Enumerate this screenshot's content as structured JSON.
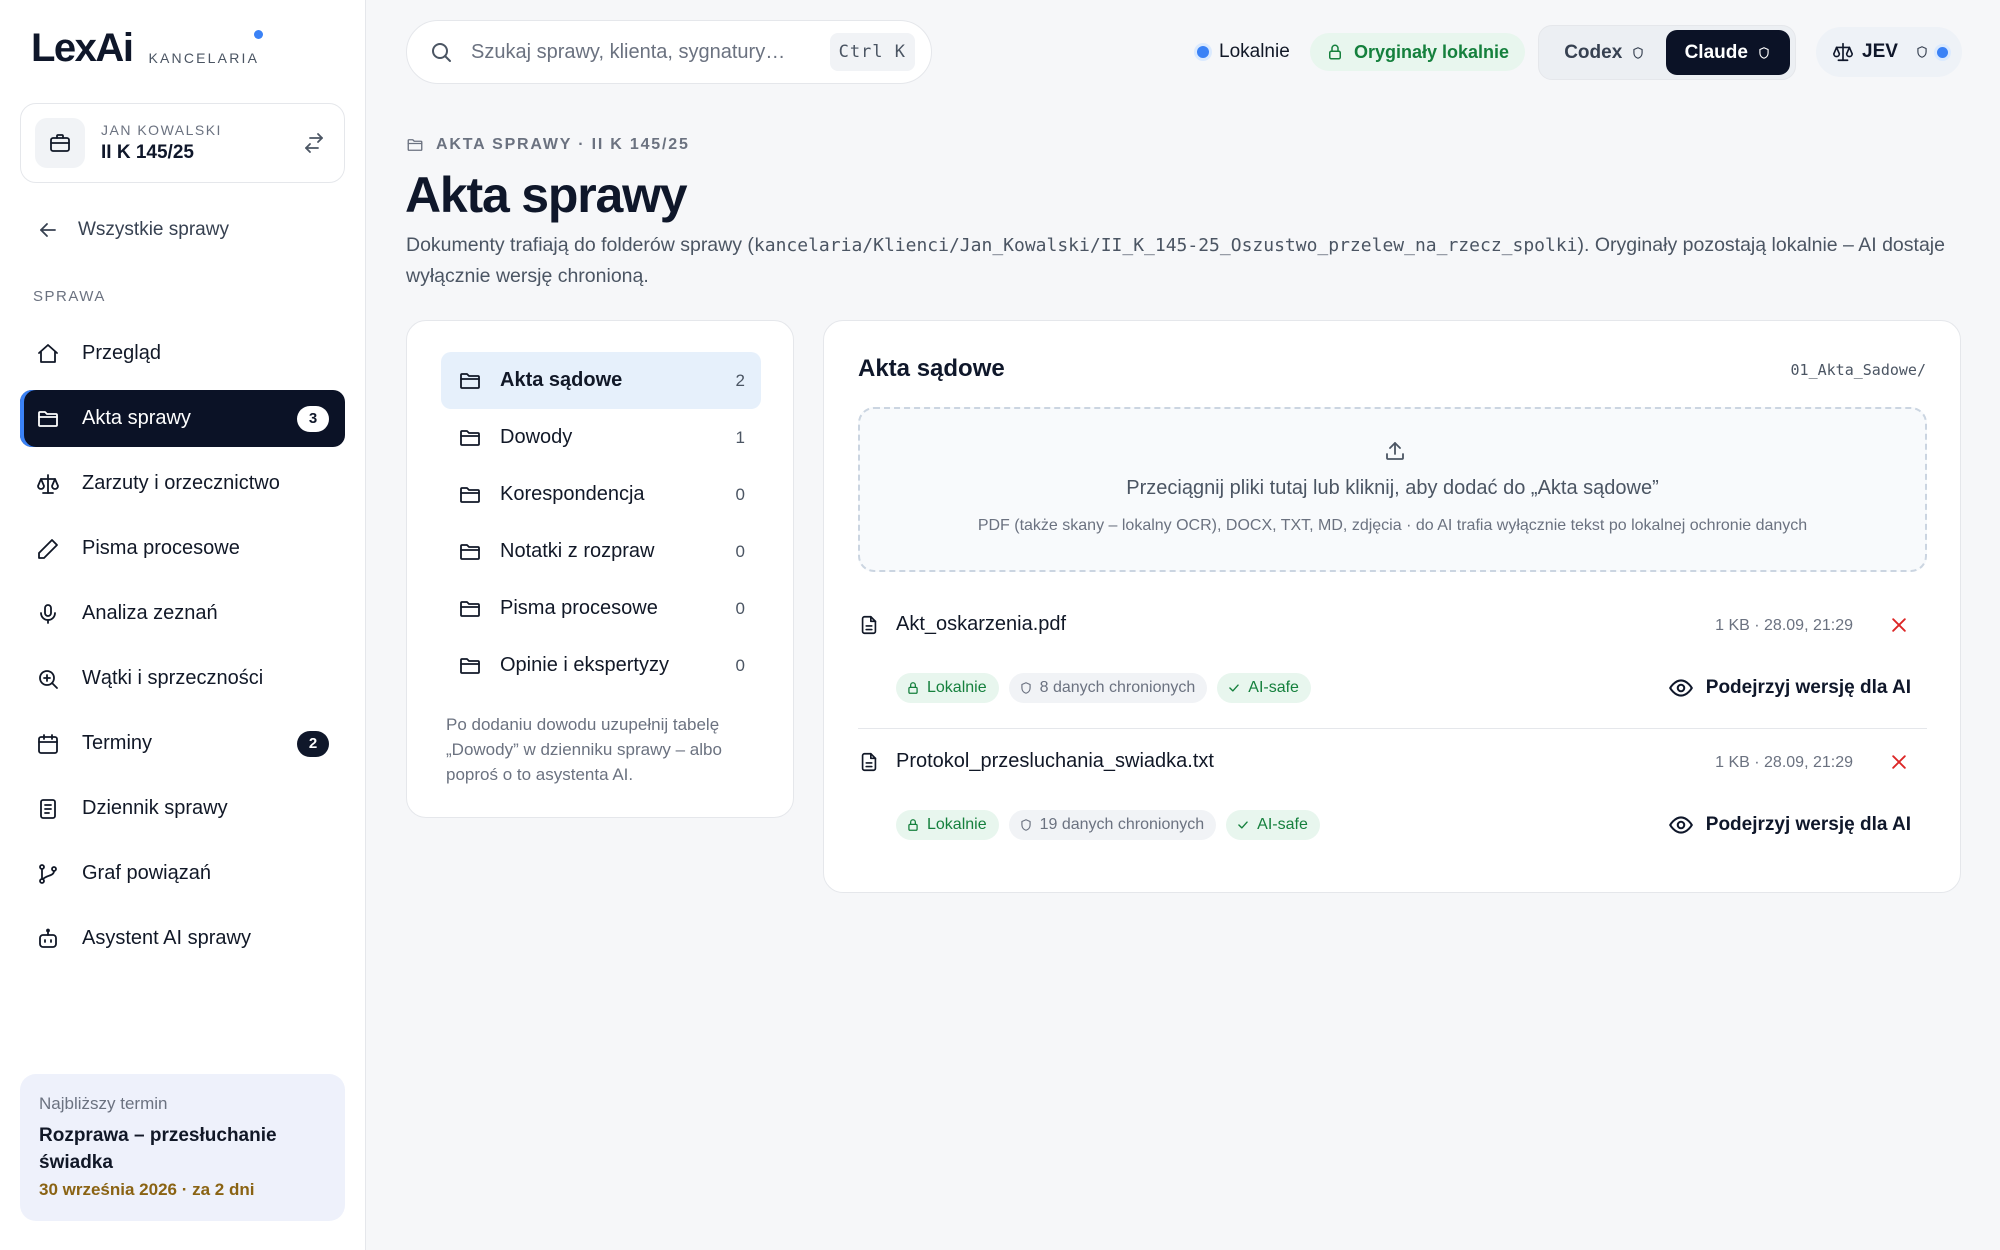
{
  "brand": {
    "name": "LexAi",
    "subtitle": "KANCELARIA"
  },
  "case": {
    "client": "JAN KOWALSKI",
    "signature": "II K 145/25"
  },
  "sidebar": {
    "back_label": "Wszystkie sprawy",
    "section_label": "SPRAWA",
    "items": [
      {
        "label": "Przegląd",
        "icon": "home-icon",
        "badge": ""
      },
      {
        "label": "Akta sprawy",
        "icon": "folder-icon",
        "badge": "3",
        "active": true
      },
      {
        "label": "Zarzuty i orzecznictwo",
        "icon": "scales-icon",
        "badge": ""
      },
      {
        "label": "Pisma procesowe",
        "icon": "pencil-icon",
        "badge": ""
      },
      {
        "label": "Analiza zeznań",
        "icon": "microphone-icon",
        "badge": ""
      },
      {
        "label": "Wątki i sprzeczności",
        "icon": "zoom-in-icon",
        "badge": ""
      },
      {
        "label": "Terminy",
        "icon": "calendar-icon",
        "badge": "2"
      },
      {
        "label": "Dziennik sprawy",
        "icon": "journal-icon",
        "badge": ""
      },
      {
        "label": "Graf powiązań",
        "icon": "git-branch-icon",
        "badge": ""
      },
      {
        "label": "Asystent AI sprawy",
        "icon": "bot-icon",
        "badge": ""
      }
    ],
    "deadline": {
      "label": "Najbliższy termin",
      "title": "Rozprawa – przesłuchanie świadka",
      "when": "30 września 2026 · za 2 dni"
    }
  },
  "topbar": {
    "search_placeholder": "Szukaj sprawy, klienta, sygnatury…",
    "shortcut": "Ctrl K",
    "status_local": "Lokalnie",
    "originals_badge": "Oryginały lokalnie",
    "models": [
      {
        "label": "Codex",
        "active": false
      },
      {
        "label": "Claude",
        "active": true
      }
    ],
    "user_initials": "JEV"
  },
  "page": {
    "breadcrumb": "AKTA SPRAWY · II K 145/25",
    "title": "Akta sprawy",
    "desc_prefix": "Dokumenty trafiają do folderów sprawy (",
    "desc_path": "kancelaria/Klienci/Jan_Kowalski/II_K_145-25_Oszustwo_przelew_na_rzecz_spolki",
    "desc_suffix": "). Oryginały pozostają lokalnie – AI dostaje wyłącznie wersję chronioną."
  },
  "folders": {
    "items": [
      {
        "label": "Akta sądowe",
        "count": "2",
        "active": true
      },
      {
        "label": "Dowody",
        "count": "1"
      },
      {
        "label": "Korespondencja",
        "count": "0"
      },
      {
        "label": "Notatki z rozpraw",
        "count": "0"
      },
      {
        "label": "Pisma procesowe",
        "count": "0"
      },
      {
        "label": "Opinie i ekspertyzy",
        "count": "0"
      }
    ],
    "note": "Po dodaniu dowodu uzupełnij tabelę „Dowody” w dzienniku sprawy – albo poproś o to asystenta AI."
  },
  "files": {
    "title": "Akta sądowe",
    "path": "01_Akta_Sadowe/",
    "dropzone_main": "Przeciągnij pliki tutaj lub kliknij, aby dodać do „Akta sądowe”",
    "dropzone_sub": "PDF (także skany – lokalny OCR), DOCX, TXT, MD, zdjęcia · do AI trafia wyłącznie tekst po lokalnej ochronie danych",
    "preview_label": "Podejrzyj wersję dla AI",
    "items": [
      {
        "name": "Akt_oskarzenia.pdf",
        "meta": "1 KB · 28.09, 21:29",
        "tag_local": "Lokalnie",
        "tag_protected": "8 danych chronionych",
        "tag_safe": "AI-safe"
      },
      {
        "name": "Protokol_przesluchania_swiadka.txt",
        "meta": "1 KB · 28.09, 21:29",
        "tag_local": "Lokalnie",
        "tag_protected": "19 danych chronionych",
        "tag_safe": "AI-safe"
      }
    ]
  },
  "colors": {
    "accent": "#3b82f6",
    "navy": "#0b1226",
    "green": "#15803d",
    "deadline_date": "#8a6313"
  }
}
